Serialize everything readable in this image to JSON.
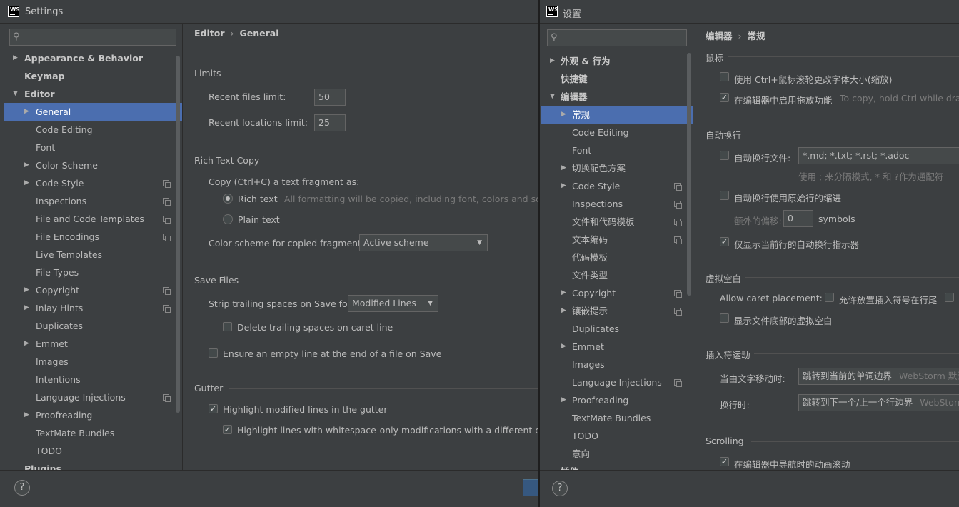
{
  "left": {
    "title": "Settings",
    "search_placeholder": "",
    "tree": [
      {
        "label": "Appearance & Behavior",
        "bold": true,
        "arrow": "▶",
        "indent": 0
      },
      {
        "label": "Keymap",
        "bold": true,
        "arrow": "",
        "indent": 0
      },
      {
        "label": "Editor",
        "bold": true,
        "arrow": "▼",
        "indent": 0
      },
      {
        "label": "General",
        "arrow": "▶",
        "indent": 1,
        "selected": true
      },
      {
        "label": "Code Editing",
        "arrow": "",
        "indent": 1
      },
      {
        "label": "Font",
        "arrow": "",
        "indent": 1
      },
      {
        "label": "Color Scheme",
        "arrow": "▶",
        "indent": 1
      },
      {
        "label": "Code Style",
        "arrow": "▶",
        "indent": 1,
        "copy": true
      },
      {
        "label": "Inspections",
        "arrow": "",
        "indent": 1,
        "copy": true
      },
      {
        "label": "File and Code Templates",
        "arrow": "",
        "indent": 1,
        "copy": true
      },
      {
        "label": "File Encodings",
        "arrow": "",
        "indent": 1,
        "copy": true
      },
      {
        "label": "Live Templates",
        "arrow": "",
        "indent": 1
      },
      {
        "label": "File Types",
        "arrow": "",
        "indent": 1
      },
      {
        "label": "Copyright",
        "arrow": "▶",
        "indent": 1,
        "copy": true
      },
      {
        "label": "Inlay Hints",
        "arrow": "▶",
        "indent": 1,
        "copy": true
      },
      {
        "label": "Duplicates",
        "arrow": "",
        "indent": 1
      },
      {
        "label": "Emmet",
        "arrow": "▶",
        "indent": 1
      },
      {
        "label": "Images",
        "arrow": "",
        "indent": 1
      },
      {
        "label": "Intentions",
        "arrow": "",
        "indent": 1
      },
      {
        "label": "Language Injections",
        "arrow": "",
        "indent": 1,
        "copy": true
      },
      {
        "label": "Proofreading",
        "arrow": "▶",
        "indent": 1
      },
      {
        "label": "TextMate Bundles",
        "arrow": "",
        "indent": 1
      },
      {
        "label": "TODO",
        "arrow": "",
        "indent": 1
      },
      {
        "label": "Plugins",
        "bold": true,
        "arrow": "",
        "indent": 0
      }
    ],
    "breadcrumb": {
      "parent": "Editor",
      "sep": "›",
      "current": "General"
    },
    "limits": {
      "title": "Limits",
      "recent_files_label": "Recent files limit:",
      "recent_files_value": "50",
      "recent_locations_label": "Recent locations limit:",
      "recent_locations_value": "25"
    },
    "rich": {
      "title": "Rich-Text Copy",
      "copy_label": "Copy (Ctrl+C) a text fragment as:",
      "rich_text": "Rich text",
      "rich_hint": "All formatting will be copied, including font, colors and so on",
      "plain_text": "Plain text",
      "scheme_label": "Color scheme for copied fragment:",
      "scheme_value": "Active scheme"
    },
    "save": {
      "title": "Save Files",
      "strip_label": "Strip trailing spaces on Save for:",
      "strip_value": "Modified Lines",
      "delete_caret": "Delete trailing spaces on caret line",
      "ensure_empty": "Ensure an empty line at the end of a file on Save"
    },
    "gutter": {
      "title": "Gutter",
      "highlight_modified": "Highlight modified lines in the gutter",
      "highlight_ws": "Highlight lines with whitespace-only modifications with a different color"
    },
    "help": "?"
  },
  "right": {
    "title": "设置",
    "tree": [
      {
        "label": "外观 & 行为",
        "bold": true,
        "arrow": "▶",
        "indent": 0
      },
      {
        "label": "快捷键",
        "bold": true,
        "arrow": "",
        "indent": 0
      },
      {
        "label": "编辑器",
        "bold": true,
        "arrow": "▼",
        "indent": 0
      },
      {
        "label": "常规",
        "arrow": "▶",
        "indent": 1,
        "selected": true
      },
      {
        "label": "Code Editing",
        "arrow": "",
        "indent": 1
      },
      {
        "label": "Font",
        "arrow": "",
        "indent": 1
      },
      {
        "label": "切换配色方案",
        "arrow": "▶",
        "indent": 1
      },
      {
        "label": "Code Style",
        "arrow": "▶",
        "indent": 1,
        "copy": true
      },
      {
        "label": "Inspections",
        "arrow": "",
        "indent": 1,
        "copy": true
      },
      {
        "label": "文件和代码模板",
        "arrow": "",
        "indent": 1,
        "copy": true
      },
      {
        "label": "文本编码",
        "arrow": "",
        "indent": 1,
        "copy": true
      },
      {
        "label": "代码模板",
        "arrow": "",
        "indent": 1
      },
      {
        "label": "文件类型",
        "arrow": "",
        "indent": 1
      },
      {
        "label": "Copyright",
        "arrow": "▶",
        "indent": 1,
        "copy": true
      },
      {
        "label": "镶嵌提示",
        "arrow": "▶",
        "indent": 1,
        "copy": true
      },
      {
        "label": "Duplicates",
        "arrow": "",
        "indent": 1
      },
      {
        "label": "Emmet",
        "arrow": "▶",
        "indent": 1
      },
      {
        "label": "Images",
        "arrow": "",
        "indent": 1
      },
      {
        "label": "Language Injections",
        "arrow": "",
        "indent": 1,
        "copy": true
      },
      {
        "label": "Proofreading",
        "arrow": "▶",
        "indent": 1
      },
      {
        "label": "TextMate Bundles",
        "arrow": "",
        "indent": 1
      },
      {
        "label": "TODO",
        "arrow": "",
        "indent": 1
      },
      {
        "label": "意向",
        "arrow": "",
        "indent": 1
      },
      {
        "label": "插件",
        "bold": true,
        "arrow": "",
        "indent": 0
      }
    ],
    "breadcrumb": {
      "parent": "编辑器",
      "sep": "›",
      "current": "常规"
    },
    "mouse": {
      "title": "鼠标",
      "ctrl_wheel": "使用 Ctrl+鼠标滚轮更改字体大小(缩放)",
      "drag_drop": "在编辑器中启用拖放功能",
      "drag_hint": "To copy, hold Ctrl while dragging"
    },
    "softwrap": {
      "title": "自动换行",
      "files_label": "自动换行文件:",
      "files_value": "*.md; *.txt; *.rst; *.adoc",
      "files_hint": "使用 ; 来分隔模式, * 和 ?作为通配符",
      "original_indent": "自动换行使用原始行的缩进",
      "extra_label": "额外的偏移:",
      "extra_value": "0",
      "symbols": "symbols",
      "current_only": "仅显示当前行的自动换行指示器"
    },
    "virtual": {
      "title": "虚拟空白",
      "caret_label": "Allow caret placement:",
      "caret_after": "允许放置插入符号在行尾",
      "show_bottom": "显示文件底部的虚拟空白"
    },
    "caret": {
      "title": "插入符运动",
      "word_label": "当由文字移动时:",
      "word_value": "跳转到当前的单词边界",
      "word_hint": "WebStorm 默认",
      "line_label": "换行时:",
      "line_value": "跳转到下一个/上一个行边界",
      "line_hint": "WebStorm"
    },
    "scrolling": {
      "title": "Scrolling",
      "animated": "在编辑器中导航时的动画滚动"
    },
    "help": "?"
  }
}
